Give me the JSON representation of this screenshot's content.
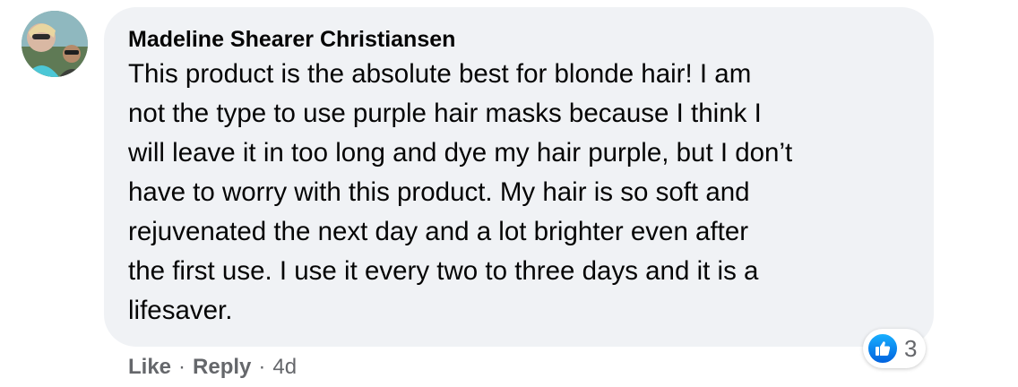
{
  "comment": {
    "author": "Madeline Shearer Christiansen",
    "text_lines": [
      "This product is the absolute best for blonde hair! I am",
      "not the type to use purple hair masks because I think I",
      "will leave it in too long and dye my hair purple, but I don’t",
      "have to worry with this product. My hair is so soft and",
      "rejuvenated the next day and a lot brighter even after",
      "the first use. I use it every two to three days and it is a",
      "lifesaver."
    ],
    "reactions": {
      "icon": "thumbs-up-icon",
      "count": "3",
      "color": "#1877f2"
    }
  },
  "actions": {
    "like_label": "Like",
    "separator": "·",
    "reply_label": "Reply",
    "timestamp": "4d"
  },
  "colors": {
    "bubble": "#f0f2f5",
    "secondary_text": "#65676b"
  }
}
